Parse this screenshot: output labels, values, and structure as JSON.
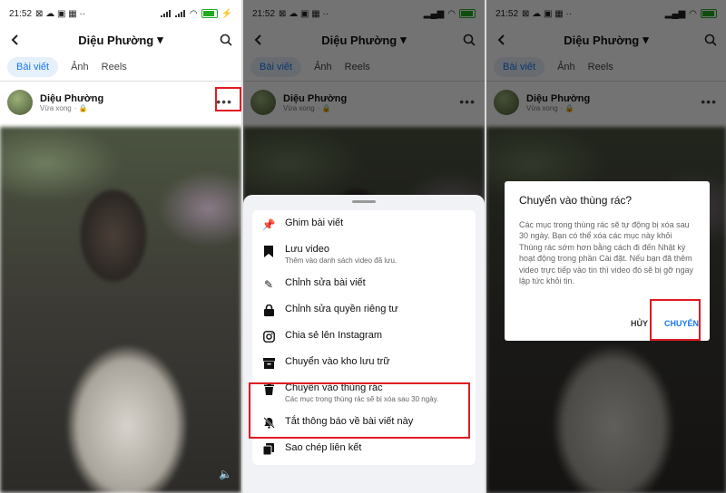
{
  "status": {
    "time": "21:52",
    "battery": "⚡"
  },
  "profile": {
    "name": "Diệu Phường"
  },
  "tabs": [
    "Bài viết",
    "Ảnh",
    "Reels"
  ],
  "post": {
    "author": "Diệu Phường",
    "time": "Vừa xong"
  },
  "menu": {
    "items": [
      {
        "icon": "pin-icon",
        "label": "Ghim bài viết",
        "desc": ""
      },
      {
        "icon": "bookmark-icon",
        "label": "Lưu video",
        "desc": "Thêm vào danh sách video đã lưu."
      },
      {
        "icon": "pencil-icon",
        "label": "Chỉnh sửa bài viết",
        "desc": ""
      },
      {
        "icon": "lock-icon",
        "label": "Chỉnh sửa quyền riêng tư",
        "desc": ""
      },
      {
        "icon": "instagram-icon",
        "label": "Chia sẻ lên Instagram",
        "desc": ""
      },
      {
        "icon": "archive-icon",
        "label": "Chuyển vào kho lưu trữ",
        "desc": ""
      },
      {
        "icon": "trash-icon",
        "label": "Chuyển vào thùng rác",
        "desc": "Các mục trong thùng rác sẽ bị xóa sau 30 ngày."
      },
      {
        "icon": "bell-off-icon",
        "label": "Tắt thông báo về bài viết này",
        "desc": ""
      },
      {
        "icon": "copy-link-icon",
        "label": "Sao chép liên kết",
        "desc": ""
      }
    ]
  },
  "dialog": {
    "title": "Chuyển vào thùng rác?",
    "body": "Các mục trong thùng rác sẽ tự động bị xóa sau 30 ngày. Bạn có thể xóa các mục này khỏi Thùng rác sớm hơn bằng cách đi đến Nhật ký hoạt động trong phần Cài đặt. Nếu bạn đã thêm video trực tiếp vào tin thì video đó sẽ bị gỡ ngay lập tức khỏi tin.",
    "cancel": "HỦY",
    "confirm": "CHUYỂN"
  },
  "colors": {
    "accent": "#1877f2",
    "highlight": "#e01b24"
  }
}
